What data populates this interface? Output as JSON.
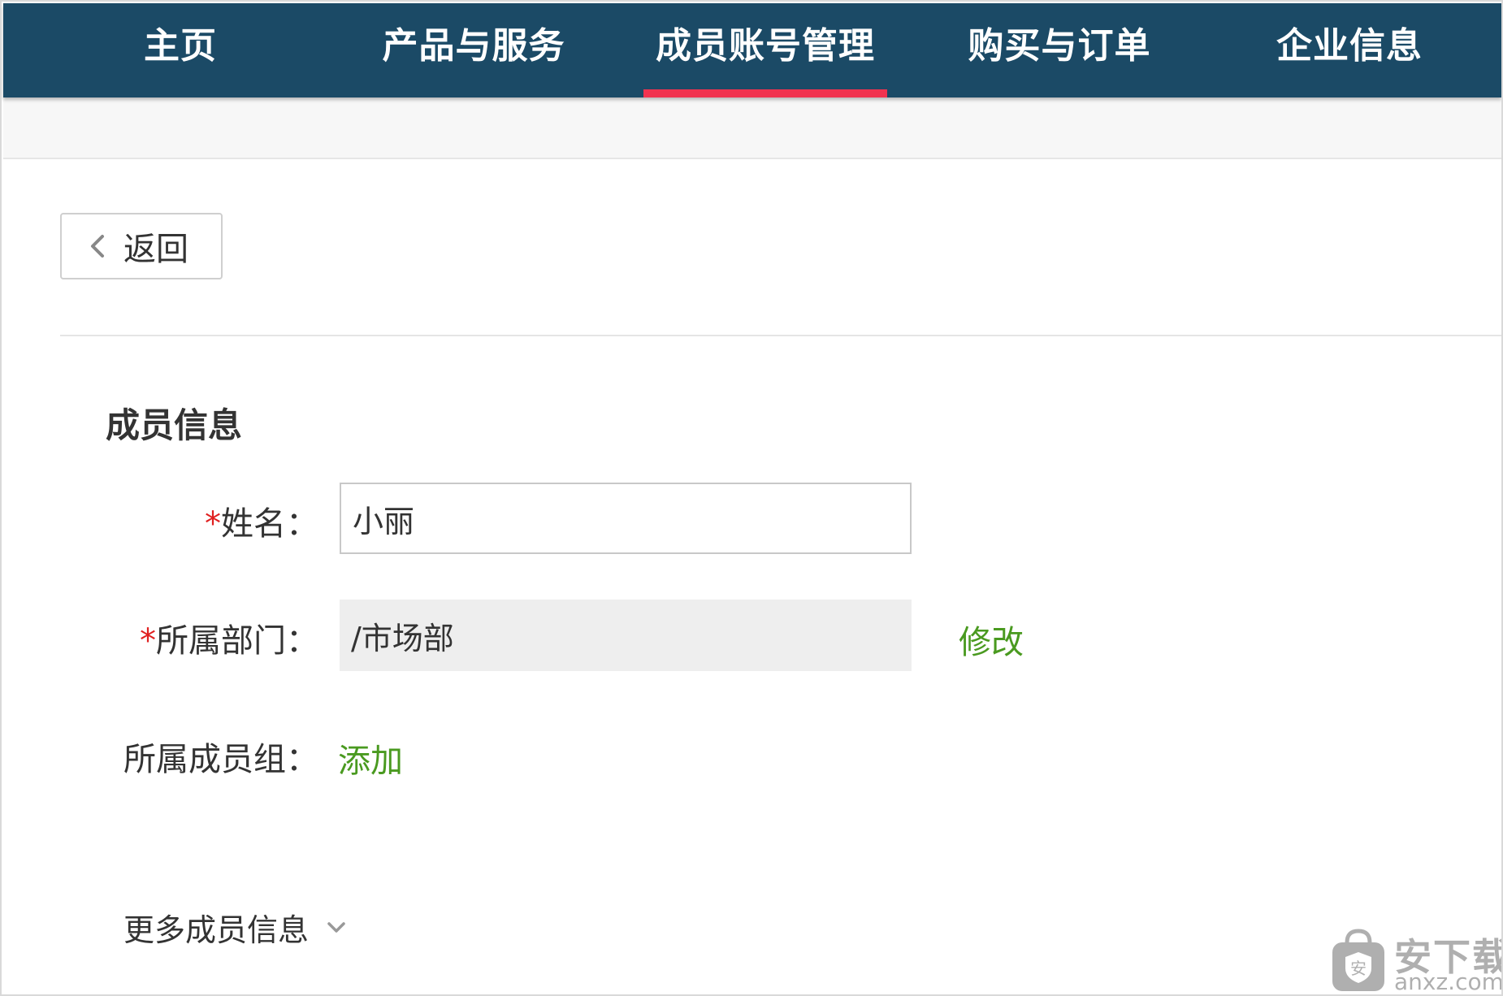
{
  "nav": {
    "items": [
      {
        "label": "主页"
      },
      {
        "label": "产品与服务"
      },
      {
        "label": "成员账号管理"
      },
      {
        "label": "购买与订单"
      },
      {
        "label": "企业信息"
      }
    ],
    "active_index": 2,
    "background_color": "#1b4a66",
    "active_indicator_color": "#f1334f"
  },
  "back_button": {
    "label": "返回",
    "icon": "chevron-left-icon"
  },
  "member_info": {
    "title": "成员信息",
    "required_mark": "*",
    "name": {
      "label": "姓名",
      "separator": "：",
      "value": "小丽"
    },
    "department": {
      "label": "所属部门",
      "separator": "：",
      "value": "/市场部",
      "action": "修改"
    },
    "member_group": {
      "label": "所属成员组",
      "separator": "：",
      "action": "添加"
    },
    "more": {
      "label": "更多成员信息",
      "icon": "chevron-down-icon"
    },
    "link_color": "#4a9a20"
  },
  "watermark": {
    "text_cn": "安下载",
    "text_en": "anxz.com",
    "icon": "shield-bag-icon"
  }
}
